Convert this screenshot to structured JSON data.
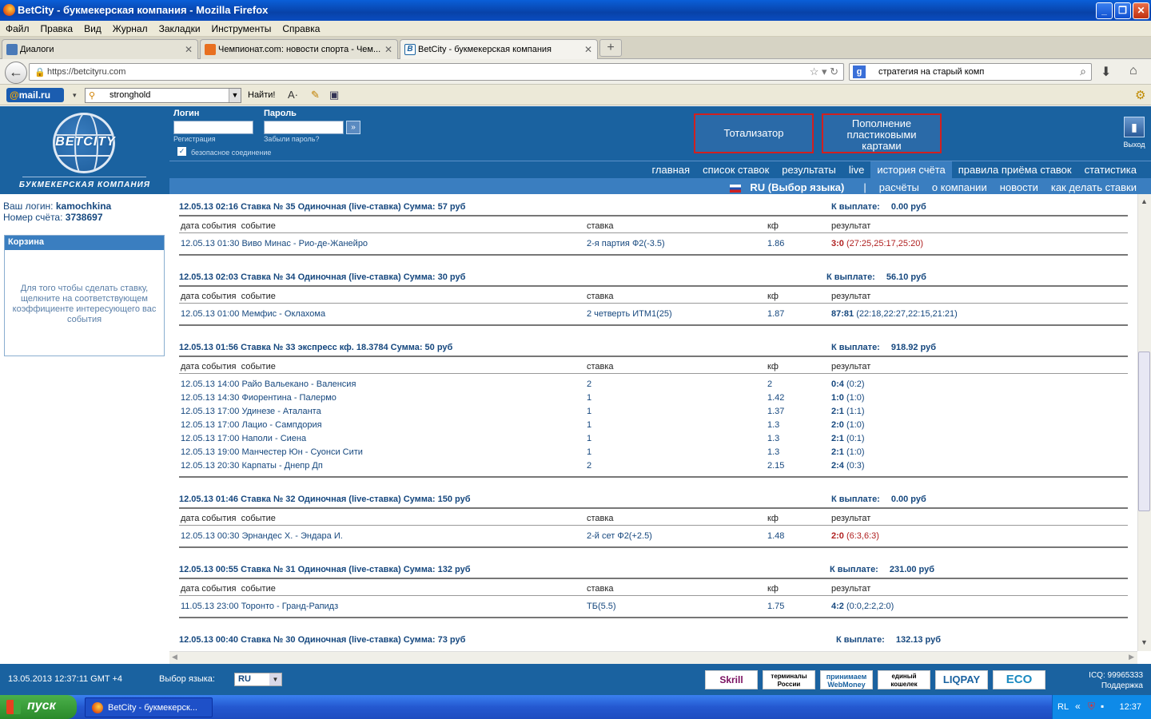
{
  "window": {
    "title": "BetCity - букмекерская компания - Mozilla Firefox"
  },
  "menu": [
    "Файл",
    "Правка",
    "Вид",
    "Журнал",
    "Закладки",
    "Инструменты",
    "Справка"
  ],
  "tabs": [
    {
      "label": "Диалоги"
    },
    {
      "label": "Чемпионат.com: новости спорта - Чем..."
    },
    {
      "label": "BetCity - букмекерская компания"
    }
  ],
  "nav": {
    "url": "https://betcityru.com",
    "search": "стратегия на старый комп"
  },
  "mailbar": {
    "logo_at": "@",
    "logo_text": "mail.ru",
    "search": "stronghold",
    "find": "Найти!"
  },
  "site": {
    "logo_name": "BETCITY",
    "logo_sub": "БУКМЕКЕРСКАЯ КОМПАНИЯ",
    "login_label": "Логин",
    "password_label": "Пароль",
    "register": "Регистрация",
    "forgot": "Забыли пароль?",
    "safe": "безопасное соединение",
    "go": "»",
    "totalizator": "Тотализатор",
    "topup": "Пополнение пластиковыми картами",
    "exit": "Выход",
    "topnav": [
      "главная",
      "список ставок",
      "результаты",
      "live",
      "история счёта",
      "правила приёма ставок",
      "статистика"
    ],
    "lang_choice": "RU (Выбор языка)",
    "sep": "|",
    "subnav": [
      "расчёты",
      "о компании",
      "новости",
      "как делать ставки"
    ]
  },
  "account": {
    "login_label": "Ваш логин:",
    "login": "kamochkina",
    "number_label": "Номер счёта:",
    "number": "3738697"
  },
  "basket": {
    "title": "Корзина",
    "text": "Для того чтобы сделать ставку, щелкните на соответствующем коэффициенте интересующего вас события"
  },
  "columns": {
    "date_event": "дата события",
    "event": "событие",
    "bet": "ставка",
    "coef": "кф",
    "result": "результат"
  },
  "bets": [
    {
      "header": "12.05.13 02:16  Ставка № 35  Одиночная (live-ставка)  Сумма: 57 руб",
      "payout_label": "К выплате:",
      "payout": "0.00 руб",
      "rows": [
        {
          "when": "12.05.13 01:30",
          "event": "Виво Минас - Рио-де-Жанейро",
          "bet": "2-я партия Ф2(-3.5)",
          "kf": "1.86",
          "score": "3:0",
          "detail": "(27:25,25:17,25:20)",
          "lost": true
        }
      ]
    },
    {
      "header": "12.05.13 02:03  Ставка № 34  Одиночная (live-ставка)  Сумма: 30 руб",
      "payout_label": "К выплате:",
      "payout": "56.10 руб",
      "rows": [
        {
          "when": "12.05.13 01:00",
          "event": "Мемфис - Оклахома",
          "bet": "2 четверть ИТМ1(25)",
          "kf": "1.87",
          "score": "87:81",
          "detail": "(22:18,22:27,22:15,21:21)",
          "lost": false
        }
      ]
    },
    {
      "header": "12.05.13 01:56  Ставка № 33  экспресс кф. 18.3784  Сумма: 50 руб",
      "payout_label": "К выплате:",
      "payout": "918.92 руб",
      "rows": [
        {
          "when": "12.05.13 14:00",
          "event": "Райо Вальекано - Валенсия",
          "bet": "2",
          "kf": "2",
          "score": "0:4",
          "detail": "(0:2)",
          "lost": false
        },
        {
          "when": "12.05.13 14:30",
          "event": "Фиорентина - Палермо",
          "bet": "1",
          "kf": "1.42",
          "score": "1:0",
          "detail": "(1:0)",
          "lost": false
        },
        {
          "when": "12.05.13 17:00",
          "event": "Удинезе - Аталанта",
          "bet": "1",
          "kf": "1.37",
          "score": "2:1",
          "detail": "(1:1)",
          "lost": false
        },
        {
          "when": "12.05.13 17:00",
          "event": "Лацио - Сампдория",
          "bet": "1",
          "kf": "1.3",
          "score": "2:0",
          "detail": "(1:0)",
          "lost": false
        },
        {
          "when": "12.05.13 17:00",
          "event": "Наполи - Сиена",
          "bet": "1",
          "kf": "1.3",
          "score": "2:1",
          "detail": "(0:1)",
          "lost": false
        },
        {
          "when": "12.05.13 19:00",
          "event": "Манчестер Юн - Суонси Сити",
          "bet": "1",
          "kf": "1.3",
          "score": "2:1",
          "detail": "(1:0)",
          "lost": false
        },
        {
          "when": "12.05.13 20:30",
          "event": "Карпаты - Днепр Дп",
          "bet": "2",
          "kf": "2.15",
          "score": "2:4",
          "detail": "(0:3)",
          "lost": false
        }
      ]
    },
    {
      "header": "12.05.13 01:46  Ставка № 32  Одиночная (live-ставка)  Сумма: 150 руб",
      "payout_label": "К выплате:",
      "payout": "0.00 руб",
      "rows": [
        {
          "when": "12.05.13 00:30",
          "event": "Эрнандес Х. - Эндара И.",
          "bet": "2-й сет Ф2(+2.5)",
          "kf": "1.48",
          "score": "2:0",
          "detail": "(6:3,6:3)",
          "lost": true
        }
      ]
    },
    {
      "header": "12.05.13 00:55  Ставка № 31  Одиночная (live-ставка)  Сумма: 132 руб",
      "payout_label": "К выплате:",
      "payout": "231.00 руб",
      "rows": [
        {
          "when": "11.05.13 23:00",
          "event": "Торонто - Гранд-Рапидз",
          "bet": "ТБ(5.5)",
          "kf": "1.75",
          "score": "4:2",
          "detail": "(0:0,2:2,2:0)",
          "lost": false
        }
      ]
    },
    {
      "header": "12.05.13 00:40  Ставка № 30  Одиночная (live-ставка)  Сумма: 73 руб",
      "payout_label": "К выплате:",
      "payout": "132.13 руб",
      "rows": []
    }
  ],
  "footer": {
    "datetime": "13.05.2013  12:37:11  GMT +4",
    "lang_label": "Выбор языка:",
    "lang": "RU",
    "icq": "ICQ: 99965333",
    "support": "Поддержка",
    "payments": [
      "Skrill",
      "терминалы России",
      "принимаем WebMoney",
      "единый кошелек",
      "LIQPAY",
      "ECO"
    ]
  },
  "taskbar": {
    "start": "пуск",
    "item": "BetCity - букмекерск...",
    "lang": "RL",
    "clock": "12:37"
  },
  "colors": {
    "site_blue": "#1a62a0",
    "nav_light": "#3a7ec0",
    "text_blue": "#15477e",
    "lost_red": "#b02020",
    "box_red": "#d02020"
  }
}
